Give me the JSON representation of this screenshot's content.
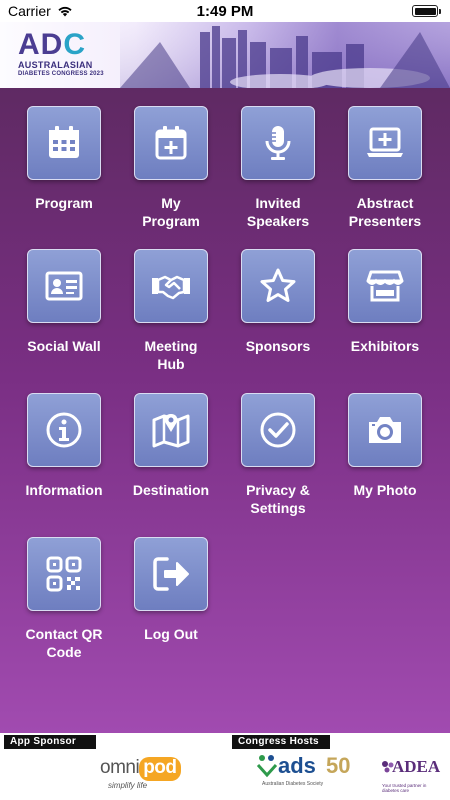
{
  "status_bar": {
    "carrier": "Carrier",
    "time": "1:49 PM",
    "battery_level": 1.0
  },
  "banner": {
    "logo_text": "ADC",
    "logo_line1": "AUSTRALASIAN",
    "logo_line2": "DIABETES CONGRESS 2023"
  },
  "tiles": [
    {
      "label": "Program",
      "icon": "calendar-icon"
    },
    {
      "label": "My\nProgram",
      "icon": "calendar-add-icon"
    },
    {
      "label": "Invited\nSpeakers",
      "icon": "microphone-icon"
    },
    {
      "label": "Abstract\nPresenters",
      "icon": "laptop-add-icon"
    },
    {
      "label": "Social Wall",
      "icon": "id-card-icon"
    },
    {
      "label": "Meeting\nHub",
      "icon": "handshake-icon"
    },
    {
      "label": "Sponsors",
      "icon": "star-icon"
    },
    {
      "label": "Exhibitors",
      "icon": "store-icon"
    },
    {
      "label": "Information",
      "icon": "info-icon"
    },
    {
      "label": "Destination",
      "icon": "map-icon"
    },
    {
      "label": "Privacy &\nSettings",
      "icon": "check-circle-icon"
    },
    {
      "label": "My Photo",
      "icon": "camera-icon"
    },
    {
      "label": "Contact QR\nCode",
      "icon": "qr-code-icon"
    },
    {
      "label": "Log Out",
      "icon": "logout-icon"
    }
  ],
  "footer": {
    "sponsor_tag": "App Sponsor",
    "hosts_tag": "Congress Hosts",
    "omnipod_name": "omnipod",
    "omnipod_omni": "omni",
    "omnipod_pod": "pod",
    "omnipod_tagline": "simplify life",
    "ads_name": "ads",
    "ads_years": "50",
    "ads_subtitle": "Australian Diabetes Society",
    "adea_name": "ADEA",
    "adea_subtitle": "Your trusted partner in diabetes care"
  },
  "colors": {
    "grid_top": "#5f2a63",
    "grid_bottom": "#a14bb0",
    "tile_fill": "#7f90cc",
    "tile_border": "#d9dcf2"
  }
}
